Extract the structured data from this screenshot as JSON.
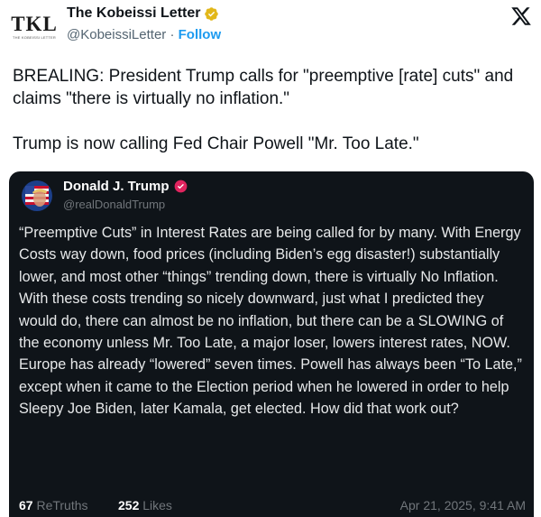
{
  "post": {
    "author": {
      "avatar_logo": "TKL",
      "avatar_tagline": "THE KOBEISSI LETTER",
      "name": "The Kobeissi Letter",
      "verified_badge": "verified-gold-icon",
      "handle": "@KobeissiLetter",
      "separator": "·",
      "follow_label": "Follow"
    },
    "platform_icon": "x-logo-icon",
    "text_paragraphs": [
      "BREALING: President Trump calls for \"preemptive [rate] cuts\" and claims \"there is virtually no inflation.\"",
      "Trump is now calling Fed Chair Powell \"Mr. Too Late.\""
    ]
  },
  "embedded_post": {
    "author": {
      "name": "Donald J. Trump",
      "verified_badge": "verified-pink-icon",
      "handle": "@realDonaldTrump"
    },
    "body": "“Preemptive Cuts” in Interest Rates are being called for by many. With Energy Costs way down, food prices (including Biden’s egg disaster!) substantially lower, and most other “things” trending down, there is virtually No Inflation. With these costs trending so nicely downward, just what I predicted they would do, there can almost be no inflation, but there can be a SLOWING of the economy unless Mr. Too Late, a major loser, lowers interest rates, NOW. Europe has already “lowered” seven times. Powell has always been “To Late,” except when it came to the Election period when he lowered in order to help Sleepy Joe Biden, later Kamala, get elected. How did that work out?",
    "stats": {
      "retruths_count": "67",
      "retruths_label": "ReTruths",
      "likes_count": "252",
      "likes_label": "Likes"
    },
    "timestamp": "Apr 21, 2025, 9:41 AM"
  },
  "colors": {
    "link_blue": "#1d9bf0",
    "card_background": "#0f1419",
    "verified_gold": "#e2b719",
    "verified_pink": "#e0245e"
  }
}
